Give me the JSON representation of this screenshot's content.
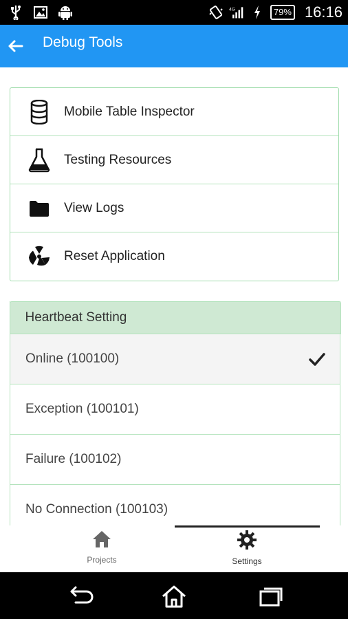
{
  "status_bar": {
    "battery": "79%",
    "time": "16:16",
    "network": "4G"
  },
  "app_bar": {
    "title": "Debug Tools"
  },
  "tools": [
    {
      "label": "Mobile Table Inspector",
      "icon": "database-icon"
    },
    {
      "label": "Testing Resources",
      "icon": "flask-icon"
    },
    {
      "label": "View Logs",
      "icon": "folder-icon"
    },
    {
      "label": "Reset Application",
      "icon": "radiation-icon"
    }
  ],
  "heartbeat": {
    "header": "Heartbeat Setting",
    "options": [
      {
        "label": "Online (100100)",
        "selected": true
      },
      {
        "label": "Exception (100101)",
        "selected": false
      },
      {
        "label": "Failure (100102)",
        "selected": false
      },
      {
        "label": "No Connection (100103)",
        "selected": false
      }
    ]
  },
  "bottom_nav": {
    "projects": "Projects",
    "settings": "Settings",
    "active": "settings"
  },
  "colors": {
    "app_bar": "#2196f3",
    "card_border": "#9fdcab",
    "section_header": "#cfe9d3"
  }
}
